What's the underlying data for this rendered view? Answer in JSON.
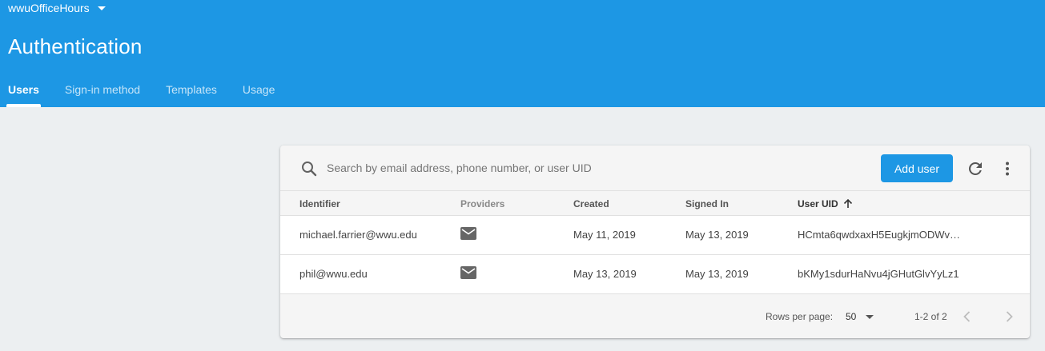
{
  "header": {
    "project_name": "wwuOfficeHours",
    "title": "Authentication",
    "tabs": [
      {
        "label": "Users",
        "active": true
      },
      {
        "label": "Sign-in method",
        "active": false
      },
      {
        "label": "Templates",
        "active": false
      },
      {
        "label": "Usage",
        "active": false
      }
    ]
  },
  "toolbar": {
    "search_placeholder": "Search by email address, phone number, or user UID",
    "add_user_label": "Add user",
    "icons": [
      "search-icon",
      "refresh-icon",
      "more-vert-icon"
    ]
  },
  "table": {
    "columns": [
      "Identifier",
      "Providers",
      "Created",
      "Signed In",
      "User UID"
    ],
    "sorted_column": "User UID",
    "sort_direction": "ascending",
    "rows": [
      {
        "identifier": "michael.farrier@wwu.edu",
        "provider_icon": "email-icon",
        "created": "May 11, 2019",
        "signed_in": "May 13, 2019",
        "uid": "HCmta6qwdxaxH5EugkjmODWvX..."
      },
      {
        "identifier": "phil@wwu.edu",
        "provider_icon": "email-icon",
        "created": "May 13, 2019",
        "signed_in": "May 13, 2019",
        "uid": "bKMy1sdurHaNvu4jGHutGlvYyLz1"
      }
    ]
  },
  "pagination": {
    "rows_per_page_label": "Rows per page:",
    "rows_per_page": "50",
    "range": "1-2 of 2"
  },
  "colors": {
    "brand": "#1d97e4",
    "background": "#eceff1"
  }
}
